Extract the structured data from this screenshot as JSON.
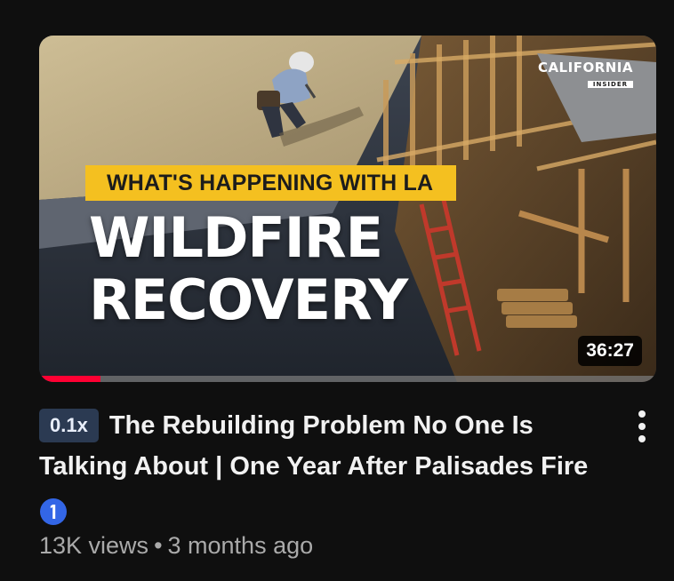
{
  "thumbnail": {
    "channel_logo_text": "CALIFORNIA",
    "channel_logo_subtext": "INSIDER",
    "banner_text": "WHAT'S HAPPENING WITH LA",
    "headline_line1": "WILDFIRE",
    "headline_line2": "RECOVERY",
    "duration": "36:27",
    "watch_progress_fraction": 0.1,
    "colors": {
      "banner": "#f4c020",
      "progress": "#ff0033"
    }
  },
  "video": {
    "speed_chip": "0.1x",
    "title": "The Rebuilding Problem No One Is Talking About | One Year After Palisades Fire",
    "views": "13K views",
    "separator": "•",
    "age": "3 months ago",
    "info_icon": "info-icon",
    "menu_icon": "more-vert-icon"
  }
}
